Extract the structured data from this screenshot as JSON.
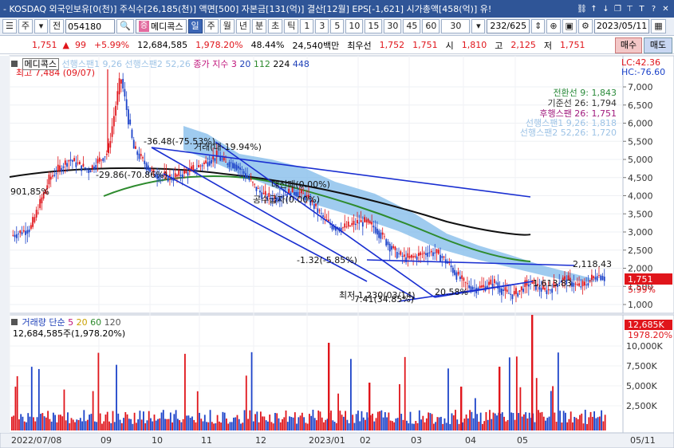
{
  "titlebar": {
    "ticker": "- KOSDAQ 외국인보유[0(천)] 주식수[26,185(천)] 액면[500] 자본금[131(억)] 결산[12월] EPS[-1,621] 시가총액[458(억)] 유!",
    "icons": [
      "link-icon",
      "arrow-up-icon",
      "arrow-down-icon",
      "copy-icon",
      "pin-icon",
      "text-icon",
      "help-icon",
      "close-icon"
    ]
  },
  "toolbar": {
    "menu_label": "주",
    "prev_label": "전",
    "code": "054180",
    "name_chip": "증",
    "name": "메디콕스",
    "periods": [
      "일",
      "주",
      "월",
      "년",
      "분",
      "초",
      "틱"
    ],
    "selected_period": "일",
    "intervals": [
      "1",
      "3",
      "5",
      "10",
      "15",
      "30",
      "45",
      "60",
      "30"
    ],
    "page_counter": "232/625",
    "date": "2023/05/11"
  },
  "quote": {
    "price": "1,751",
    "change": "99",
    "change_pct": "+5.99%",
    "volume": "12,684,585",
    "volume_ratio": "1,978.20%",
    "turnover": "48.44%",
    "amount": "24,540백만",
    "best_ask_label": "최우선",
    "best_ask": "1,752",
    "best_bid": "1,751",
    "open_label": "시",
    "open": "1,810",
    "high_label": "고",
    "high": "2,125",
    "low_label": "저",
    "low": "1,751",
    "buy_label": "매수",
    "sell_label": "매도"
  },
  "price_panel": {
    "name_tag": "메디콕스",
    "legend_items": [
      {
        "text": "선행스팬1 9,26",
        "color": "#9dc3e6"
      },
      {
        "text": "선행스팬2 52,26",
        "color": "#9dc3e6"
      },
      {
        "text": "종가 지수 3",
        "color": "#c0137a"
      },
      {
        "text": "20",
        "color": "#1d3fb8"
      },
      {
        "text": "112",
        "color": "#2e8b2e"
      },
      {
        "text": "224",
        "color": "#000000"
      },
      {
        "text": "448",
        "color": "#1d3fb8"
      }
    ],
    "lc_label": "LC:42.36",
    "hc_label": "HC:-76.60",
    "max_label": "최고 7,484 (09/07)",
    "ichimoku": [
      {
        "text": "전환선 9: 1,843",
        "color": "#2a8a3a"
      },
      {
        "text": "기준선 26: 1,794",
        "color": "#333333"
      },
      {
        "text": "후행스팬 26: 1,751",
        "color": "#a01a7d"
      },
      {
        "text": "선행스팬1 9,26: 1,818",
        "color": "#9dc3e6"
      },
      {
        "text": "선행스팬2 52,26: 1,720",
        "color": "#9dc3e6"
      }
    ],
    "annotations": [
      {
        "text": "-36.48(-75.53%)"
      },
      {
        "text": "-29.86(-70.86%)"
      },
      {
        "text": "901,85%"
      },
      {
        "text": "거래(대-19.94%)"
      },
      {
        "text": "대선패(0.00%)"
      },
      {
        "text": "공수급자(0.00%)"
      },
      {
        "text": "-1.32(-5.85%)"
      },
      {
        "text": "2,118.43"
      },
      {
        "text": "1,613.83"
      },
      {
        "text": "최저 1,230(03/14)"
      },
      {
        "text": "-7.41(34.85%)"
      },
      {
        "text": "20.58%"
      }
    ],
    "price_tag": "1,751",
    "pct_tag": "5.99%",
    "y_ticks": [
      "7,000",
      "6,500",
      "6,000",
      "5,500",
      "5,000",
      "4,500",
      "4,000",
      "3,500",
      "3,000",
      "2,500",
      "2,000",
      "1,500",
      "1,000"
    ]
  },
  "volume_panel": {
    "legend": [
      {
        "text": "거래량",
        "color": "#1d3fb8"
      },
      {
        "text": "단순",
        "color": "#1d3fb8"
      },
      {
        "text": "5",
        "color": "#c0137a"
      },
      {
        "text": "20",
        "color": "#c9a000"
      },
      {
        "text": "60",
        "color": "#2e8b2e"
      },
      {
        "text": "120",
        "color": "#555555"
      }
    ],
    "summary": "12,684,585주(1,978.20%)",
    "vol_tag": "12,685K",
    "vol_pct_tag": "1978.20%",
    "y_ticks": [
      "10,000K",
      "7,500K",
      "5,000K",
      "2,500K"
    ]
  },
  "x_axis": {
    "labels": [
      "2022/07/08",
      "09",
      "10",
      "11",
      "12",
      "2023/01",
      "02",
      "03",
      "04",
      "05"
    ],
    "right_label": "05/11"
  },
  "colors": {
    "up": "#e0151b",
    "down": "#1c43c9",
    "cloud": "#7fb9ea",
    "ma224": "#111111",
    "ma112": "#2e8b2e",
    "trend": "#1a2fd1"
  }
}
